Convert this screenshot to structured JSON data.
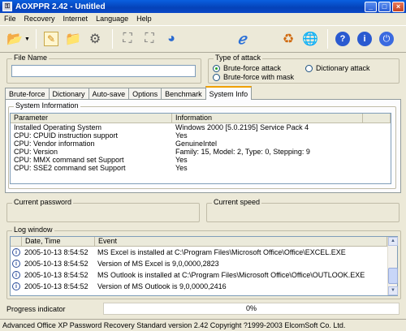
{
  "window": {
    "title": "AOXPPR 2.42 - Untitled",
    "app_icon": "key-icon"
  },
  "menu": [
    "File",
    "Recovery",
    "Internet",
    "Language",
    "Help"
  ],
  "toolbar": {
    "buttons": [
      {
        "name": "open-icon",
        "glyph": "📂"
      },
      {
        "name": "edit-icon",
        "glyph": "✎"
      },
      {
        "name": "folder-star-icon",
        "glyph": "📁"
      },
      {
        "name": "hardware-icon",
        "glyph": "⚙"
      },
      {
        "name": "run-icon",
        "glyph": "⛶"
      },
      {
        "name": "stop-icon",
        "glyph": "⛶"
      },
      {
        "name": "pie-chart-icon",
        "glyph": "◕"
      },
      {
        "name": "internet-explorer-icon",
        "glyph": "ℯ"
      },
      {
        "name": "recycle-icon",
        "glyph": "♻"
      },
      {
        "name": "globe-icon",
        "glyph": "🌐"
      },
      {
        "name": "help-icon",
        "glyph": "?"
      },
      {
        "name": "info-icon",
        "glyph": "i"
      },
      {
        "name": "exit-icon",
        "glyph": "⏻"
      }
    ]
  },
  "file_name": {
    "label": "File Name",
    "value": ""
  },
  "attack": {
    "label": "Type of attack",
    "options": [
      {
        "label": "Brute-force attack",
        "selected": true
      },
      {
        "label": "Dictionary attack",
        "selected": false
      },
      {
        "label": "Brute-force with mask",
        "selected": false
      }
    ]
  },
  "tabs": [
    "Brute-force",
    "Dictionary",
    "Auto-save",
    "Options",
    "Benchmark",
    "System Info"
  ],
  "active_tab": "System Info",
  "system_info": {
    "label": "System Information",
    "columns": [
      "Parameter",
      "Information",
      ""
    ],
    "rows": [
      [
        "Installed Operating System",
        "Windows 2000 [5.0.2195] Service Pack 4"
      ],
      [
        "CPU: CPUID instruction support",
        "Yes"
      ],
      [
        "CPU: Vendor information",
        "GenuineIntel"
      ],
      [
        "CPU: Version",
        "Family: 15, Model: 2, Type: 0, Stepping: 9"
      ],
      [
        "CPU: MMX command set Support",
        "Yes"
      ],
      [
        "CPU: SSE2 command set Support",
        "Yes"
      ]
    ]
  },
  "current_password": {
    "label": "Current password",
    "value": ""
  },
  "current_speed": {
    "label": "Current speed",
    "value": ""
  },
  "log": {
    "label": "Log window",
    "columns": [
      "",
      "Date, Time",
      "Event"
    ],
    "rows": [
      [
        "2005-10-13 8:54:52",
        "MS Excel is installed at C:\\Program Files\\Microsoft Office\\Office\\EXCEL.EXE"
      ],
      [
        "2005-10-13 8:54:52",
        "Version of MS Excel is 9,0,0000,2823"
      ],
      [
        "2005-10-13 8:54:52",
        "MS Outlook is installed at C:\\Program Files\\Microsoft Office\\Office\\OUTLOOK.EXE"
      ],
      [
        "2005-10-13 8:54:52",
        "Version of MS Outlook is 9,0,0000,2416"
      ]
    ]
  },
  "progress": {
    "label": "Progress indicator",
    "value": "0%",
    "fraction": 0
  },
  "status": "Advanced Office XP Password Recovery Standard version 2.42 Copyright ?1999-2003 ElcomSoft Co. Ltd."
}
